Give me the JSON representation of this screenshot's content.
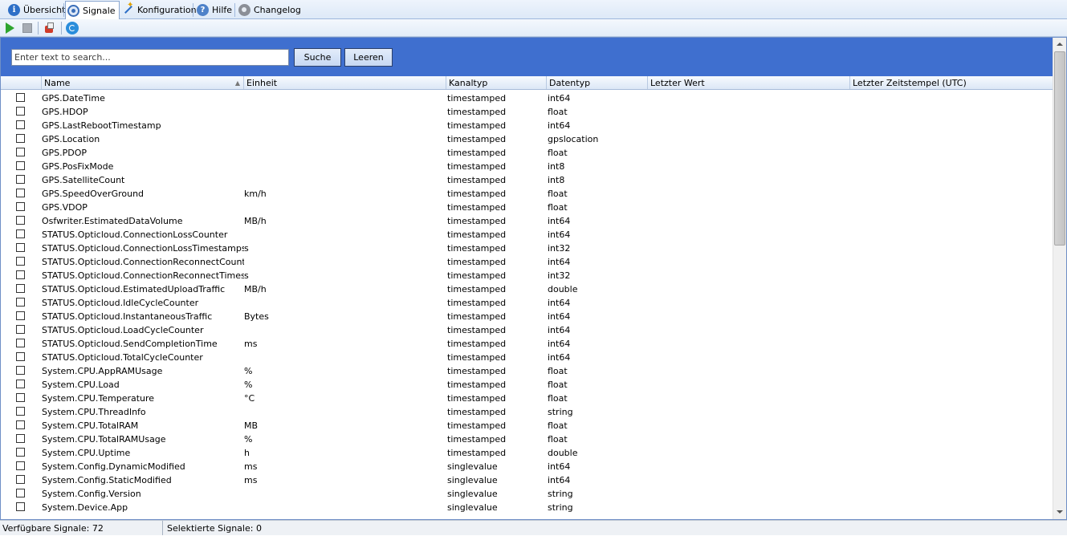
{
  "tabs": [
    {
      "label": "Übersicht",
      "icon": "info-icon",
      "active": false
    },
    {
      "label": "Signale",
      "icon": "signal-icon",
      "active": true
    },
    {
      "label": "Konfiguration",
      "icon": "wand-icon",
      "active": false
    },
    {
      "label": "Hilfe",
      "icon": "help-icon",
      "active": false
    },
    {
      "label": "Changelog",
      "icon": "gear-icon",
      "active": false
    }
  ],
  "toolbar": {
    "buttons": [
      "play-icon",
      "stop-icon",
      "export-icon",
      "refresh-icon"
    ]
  },
  "search": {
    "placeholder": "Enter text to search...",
    "value": "",
    "search_label": "Suche",
    "clear_label": "Leeren"
  },
  "table": {
    "columns": [
      "Name",
      "Einheit",
      "Kanaltyp",
      "Datentyp",
      "Letzter Wert",
      "Letzter Zeitstempel (UTC)"
    ],
    "sorted_column": "Name",
    "rows": [
      {
        "name": "GPS.DateTime",
        "unit": "",
        "channel": "timestamped",
        "type": "int64"
      },
      {
        "name": "GPS.HDOP",
        "unit": "",
        "channel": "timestamped",
        "type": "float"
      },
      {
        "name": "GPS.LastRebootTimestamp",
        "unit": "",
        "channel": "timestamped",
        "type": "int64"
      },
      {
        "name": "GPS.Location",
        "unit": "",
        "channel": "timestamped",
        "type": "gpslocation"
      },
      {
        "name": "GPS.PDOP",
        "unit": "",
        "channel": "timestamped",
        "type": "float"
      },
      {
        "name": "GPS.PosFixMode",
        "unit": "",
        "channel": "timestamped",
        "type": "int8"
      },
      {
        "name": "GPS.SatelliteCount",
        "unit": "",
        "channel": "timestamped",
        "type": "int8"
      },
      {
        "name": "GPS.SpeedOverGround",
        "unit": "km/h",
        "channel": "timestamped",
        "type": "float"
      },
      {
        "name": "GPS.VDOP",
        "unit": "",
        "channel": "timestamped",
        "type": "float"
      },
      {
        "name": "Osfwriter.EstimatedDataVolume",
        "unit": "MB/h",
        "channel": "timestamped",
        "type": "int64"
      },
      {
        "name": "STATUS.Opticloud.ConnectionLossCounter",
        "unit": "",
        "channel": "timestamped",
        "type": "int64"
      },
      {
        "name": "STATUS.Opticloud.ConnectionLossTimestamps",
        "unit": "s",
        "channel": "timestamped",
        "type": "int32"
      },
      {
        "name": "STATUS.Opticloud.ConnectionReconnectCounter",
        "unit": "",
        "channel": "timestamped",
        "type": "int64"
      },
      {
        "name": "STATUS.Opticloud.ConnectionReconnectTimestamps",
        "unit": "s",
        "channel": "timestamped",
        "type": "int32"
      },
      {
        "name": "STATUS.Opticloud.EstimatedUploadTraffic",
        "unit": "MB/h",
        "channel": "timestamped",
        "type": "double"
      },
      {
        "name": "STATUS.Opticloud.IdleCycleCounter",
        "unit": "",
        "channel": "timestamped",
        "type": "int64"
      },
      {
        "name": "STATUS.Opticloud.InstantaneousTraffic",
        "unit": "Bytes",
        "channel": "timestamped",
        "type": "int64"
      },
      {
        "name": "STATUS.Opticloud.LoadCycleCounter",
        "unit": "",
        "channel": "timestamped",
        "type": "int64"
      },
      {
        "name": "STATUS.Opticloud.SendCompletionTime",
        "unit": "ms",
        "channel": "timestamped",
        "type": "int64"
      },
      {
        "name": "STATUS.Opticloud.TotalCycleCounter",
        "unit": "",
        "channel": "timestamped",
        "type": "int64"
      },
      {
        "name": "System.CPU.AppRAMUsage",
        "unit": "%",
        "channel": "timestamped",
        "type": "float"
      },
      {
        "name": "System.CPU.Load",
        "unit": "%",
        "channel": "timestamped",
        "type": "float"
      },
      {
        "name": "System.CPU.Temperature",
        "unit": "°C",
        "channel": "timestamped",
        "type": "float"
      },
      {
        "name": "System.CPU.ThreadInfo",
        "unit": "",
        "channel": "timestamped",
        "type": "string"
      },
      {
        "name": "System.CPU.TotalRAM",
        "unit": "MB",
        "channel": "timestamped",
        "type": "float"
      },
      {
        "name": "System.CPU.TotalRAMUsage",
        "unit": "%",
        "channel": "timestamped",
        "type": "float"
      },
      {
        "name": "System.CPU.Uptime",
        "unit": "h",
        "channel": "timestamped",
        "type": "double"
      },
      {
        "name": "System.Config.DynamicModified",
        "unit": "ms",
        "channel": "singlevalue",
        "type": "int64"
      },
      {
        "name": "System.Config.StaticModified",
        "unit": "ms",
        "channel": "singlevalue",
        "type": "int64"
      },
      {
        "name": "System.Config.Version",
        "unit": "",
        "channel": "singlevalue",
        "type": "string"
      },
      {
        "name": "System.Device.App",
        "unit": "",
        "channel": "singlevalue",
        "type": "string"
      }
    ]
  },
  "status": {
    "available": "Verfügbare Signale: 72",
    "selected": "Selektierte Signale: 0"
  },
  "colors": {
    "search_bar": "#3f6fcf",
    "tab_bar": "#dde9f7",
    "header": "#dce7f6"
  }
}
